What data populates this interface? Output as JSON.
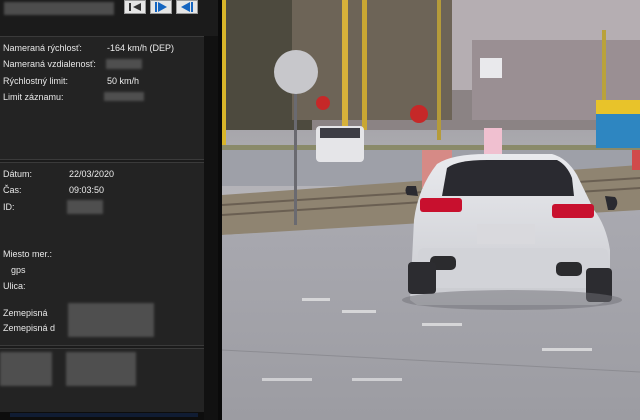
{
  "toolbar": {
    "buttons": [
      {
        "name": "first-frame-button"
      },
      {
        "name": "play-button"
      },
      {
        "name": "rewind-button"
      }
    ]
  },
  "measurement": {
    "speed_label": "Nameraná rýchlosť:",
    "speed_value": "-164 km/h (DEP)",
    "distance_label": "Nameraná vzdialenosť:",
    "limit_label": "Rýchlostný limit:",
    "limit_value": "50 km/h",
    "record_limit_label": "Limit záznamu:"
  },
  "record": {
    "date_label": "Dátum:",
    "date_value": "22/03/2020",
    "time_label": "Čas:",
    "time_value": "09:03:50",
    "id_label": "ID:"
  },
  "location": {
    "place_label": "Miesto mer.:",
    "gps_label": "gps",
    "street_label": "Ulica:",
    "lat_label": "Zemepisná",
    "lon_label": "Zemepisná d"
  },
  "colors": {
    "panel_bg": "#1b1b1b",
    "section_bg": "#232323",
    "text": "#e8e8e8",
    "car": "#dcdde1",
    "taillight": "#c8102e",
    "stop_sign": "#c62828",
    "tram": "#2e86c1"
  }
}
